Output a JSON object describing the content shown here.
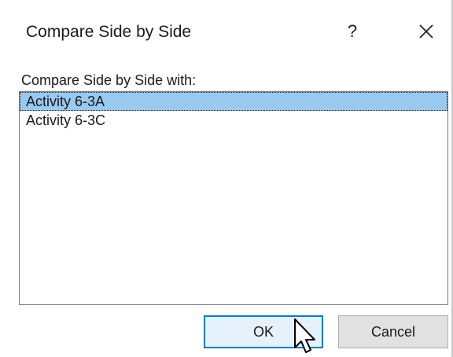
{
  "dialog": {
    "title": "Compare Side by Side",
    "help_label": "?",
    "close_icon": "close-icon"
  },
  "compare": {
    "label": "Compare Side by Side with:",
    "items": [
      {
        "label": "Activity 6-3A",
        "selected": true
      },
      {
        "label": "Activity 6-3C",
        "selected": false
      }
    ]
  },
  "buttons": {
    "ok_label": "OK",
    "cancel_label": "Cancel"
  },
  "colors": {
    "selection": "#99c9ef",
    "default_button_border": "#0078d7",
    "default_button_bg": "#e5f1fb",
    "button_bg": "#e1e1e1"
  },
  "cursor": {
    "icon": "arrow-pointer-icon"
  }
}
